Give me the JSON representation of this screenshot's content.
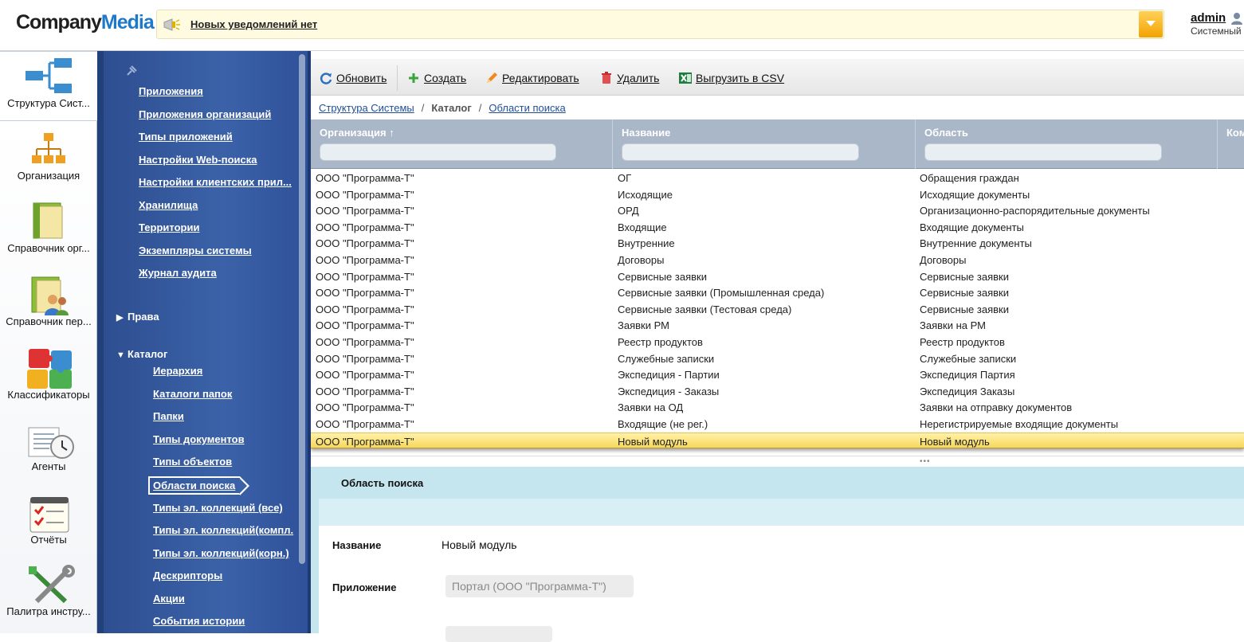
{
  "header": {
    "logo_company": "Company",
    "logo_media": "Media",
    "notification_text": "Новых уведомлений нет",
    "user_name": "admin",
    "user_role": "Системный"
  },
  "rail": {
    "items": [
      {
        "label": "Структура Сист...",
        "icon": "structure-icon",
        "active": true
      },
      {
        "label": "Организация",
        "icon": "org-chart-icon",
        "active": false
      },
      {
        "label": "Справочник орг...",
        "icon": "folder-icon",
        "active": false
      },
      {
        "label": "Справочник пер...",
        "icon": "people-folder-icon",
        "active": false
      },
      {
        "label": "Классификаторы",
        "icon": "puzzle-icon",
        "active": false
      },
      {
        "label": "Агенты",
        "icon": "clock-doc-icon",
        "active": false
      },
      {
        "label": "Отчёты",
        "icon": "checklist-icon",
        "active": false
      },
      {
        "label": "Палитра инстру...",
        "icon": "tools-icon",
        "active": false
      }
    ]
  },
  "nav": {
    "links": [
      "Приложения",
      "Приложения организаций",
      "Типы приложений",
      "Настройки Web-поиска",
      "Настройки клиентских прил...",
      "Хранилища",
      "Территории",
      "Экземпляры системы",
      "Журнал аудита"
    ],
    "group_rights": "Права",
    "group_catalog": "Каталог",
    "catalog_links": [
      "Иерархия",
      "Каталоги папок",
      "Папки",
      "Типы документов",
      "Типы объектов",
      "Области поиска",
      "Типы эл. коллекций (все)",
      "Типы эл. коллекций(компл.",
      "Типы эл. коллекций(корн.)",
      "Дескрипторы",
      "Акции",
      "События истории"
    ],
    "selected": "Области поиска"
  },
  "toolbar": {
    "refresh": "Обновить",
    "create": "Создать",
    "edit": "Редактировать",
    "delete": "Удалить",
    "export": "Выгрузить в CSV"
  },
  "breadcrumb": {
    "root": "Структура Системы",
    "middle": "Каталог",
    "current": "Области поиска",
    "separator": "/"
  },
  "table": {
    "columns": [
      "Организация ↑",
      "Название",
      "Область",
      "Ком"
    ],
    "rows": [
      [
        "ООО \"Программа-Т\"",
        "ОГ",
        "Обращения граждан"
      ],
      [
        "ООО \"Программа-Т\"",
        "Исходящие",
        "Исходящие документы"
      ],
      [
        "ООО \"Программа-Т\"",
        "ОРД",
        "Организационно-распорядительные документы"
      ],
      [
        "ООО \"Программа-Т\"",
        "Входящие",
        "Входящие документы"
      ],
      [
        "ООО \"Программа-Т\"",
        "Внутренние",
        "Внутренние документы"
      ],
      [
        "ООО \"Программа-Т\"",
        "Договоры",
        "Договоры"
      ],
      [
        "ООО \"Программа-Т\"",
        "Сервисные заявки",
        "Сервисные заявки"
      ],
      [
        "ООО \"Программа-Т\"",
        "Сервисные заявки (Промышленная среда)",
        "Сервисные заявки"
      ],
      [
        "ООО \"Программа-Т\"",
        "Сервисные заявки (Тестовая среда)",
        "Сервисные заявки"
      ],
      [
        "ООО \"Программа-Т\"",
        "Заявки РМ",
        "Заявки на РМ"
      ],
      [
        "ООО \"Программа-Т\"",
        "Реестр продуктов",
        "Реестр продуктов"
      ],
      [
        "ООО \"Программа-Т\"",
        "Служебные записки",
        "Служебные записки"
      ],
      [
        "ООО \"Программа-Т\"",
        "Экспедиция - Партии",
        "Экспедиция Партия"
      ],
      [
        "ООО \"Программа-Т\"",
        "Экспедиция - Заказы",
        "Экспедиция Заказы"
      ],
      [
        "ООО \"Программа-Т\"",
        "Заявки на ОД",
        "Заявки на отправку документов"
      ],
      [
        "ООО \"Программа-Т\"",
        "Входящие (не рег.)",
        "Нерегистрируемые входящие документы"
      ],
      [
        "ООО \"Программа-Т\"",
        "Новый модуль",
        "Новый модуль"
      ]
    ],
    "selected_row": 16
  },
  "detail": {
    "title": "Область поиска",
    "name_label": "Название",
    "name_value": "Новый модуль",
    "app_label": "Приложение",
    "app_value": "Портал (ООО \"Программа-Т\")"
  },
  "colors": {
    "nav_bg": "#3b62a8",
    "header_row": "#a9b7c8",
    "selected_row": "#f7d85c",
    "detail_bg": "#c5e6ef"
  }
}
